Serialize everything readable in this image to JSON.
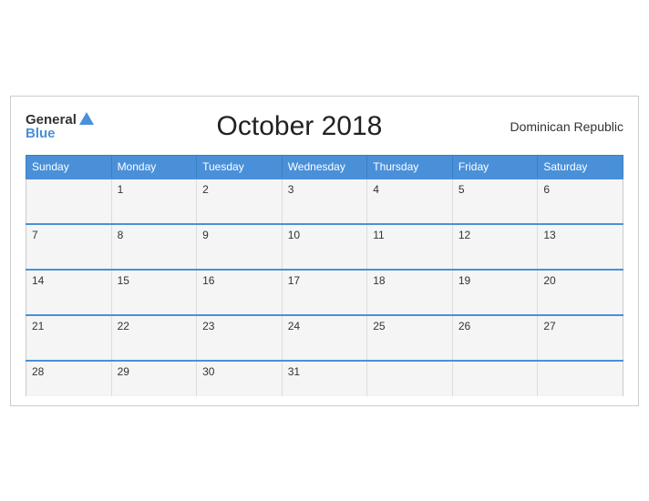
{
  "header": {
    "logo_general": "General",
    "logo_blue": "Blue",
    "title": "October 2018",
    "country": "Dominican Republic"
  },
  "days_of_week": [
    "Sunday",
    "Monday",
    "Tuesday",
    "Wednesday",
    "Thursday",
    "Friday",
    "Saturday"
  ],
  "weeks": [
    [
      "",
      "1",
      "2",
      "3",
      "4",
      "5",
      "6"
    ],
    [
      "7",
      "8",
      "9",
      "10",
      "11",
      "12",
      "13"
    ],
    [
      "14",
      "15",
      "16",
      "17",
      "18",
      "19",
      "20"
    ],
    [
      "21",
      "22",
      "23",
      "24",
      "25",
      "26",
      "27"
    ],
    [
      "28",
      "29",
      "30",
      "31",
      "",
      "",
      ""
    ]
  ]
}
